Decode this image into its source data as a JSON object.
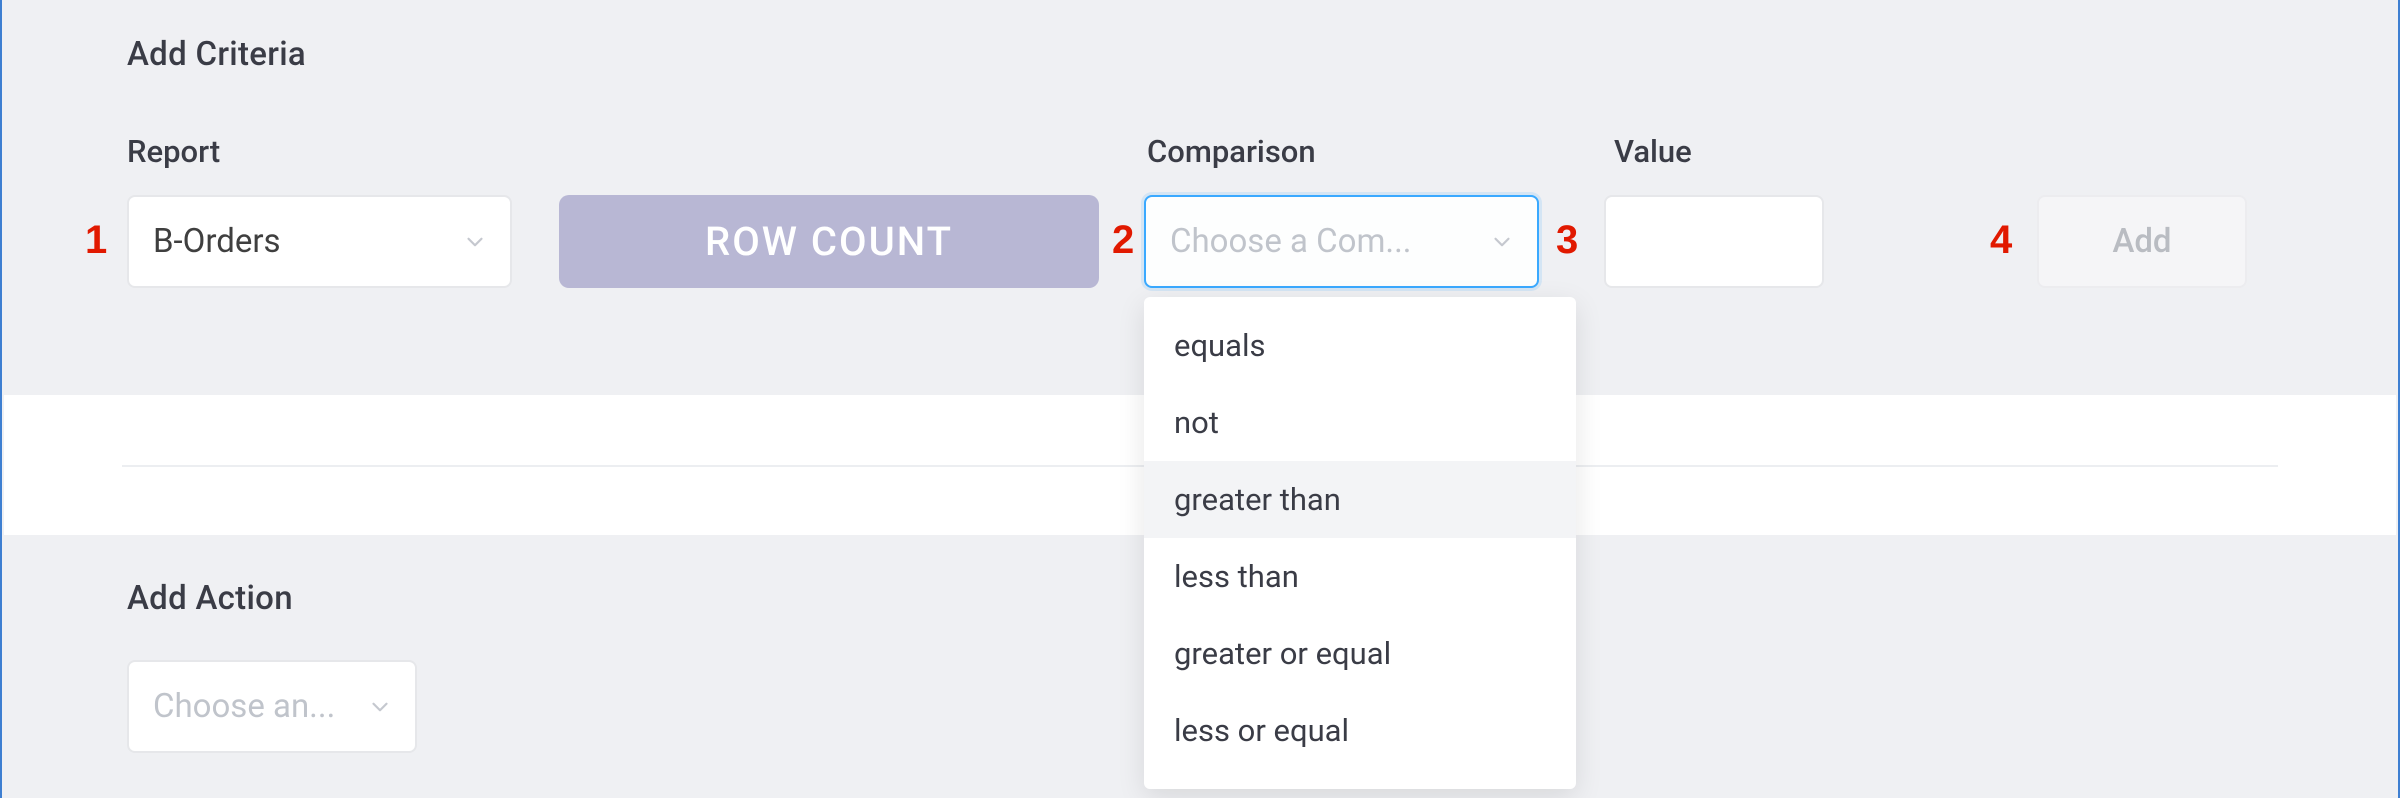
{
  "criteria": {
    "title": "Add Criteria",
    "report_label": "Report",
    "report_value": "B-Orders",
    "rowcount_label": "ROW COUNT",
    "comparison_label": "Comparison",
    "comparison_placeholder": "Choose a Com...",
    "value_label": "Value",
    "value_text": "",
    "add_button_label": "Add"
  },
  "comparison_options": [
    {
      "label": "equals",
      "hovered": false
    },
    {
      "label": "not",
      "hovered": false
    },
    {
      "label": "greater than",
      "hovered": true
    },
    {
      "label": "less than",
      "hovered": false
    },
    {
      "label": "greater or equal",
      "hovered": false
    },
    {
      "label": "less or equal",
      "hovered": false
    }
  ],
  "action": {
    "title": "Add Action",
    "select_placeholder": "Choose an..."
  },
  "callouts": {
    "c1": "1",
    "c2": "2",
    "c3": "3",
    "c4": "4"
  }
}
